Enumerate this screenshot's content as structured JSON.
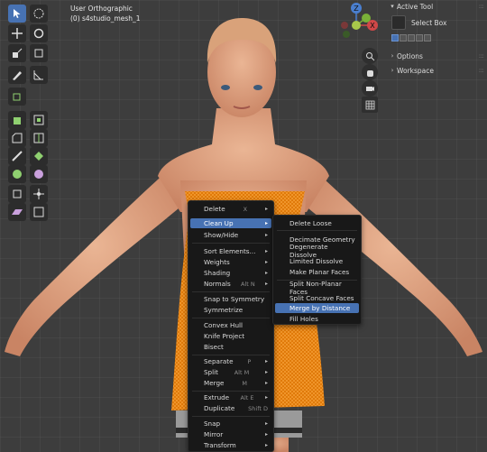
{
  "viewport": {
    "view_name": "User Orthographic",
    "object_name": "(0) s4studio_mesh_1"
  },
  "gizmo": {
    "axes": [
      "X",
      "Y",
      "Z"
    ]
  },
  "side_panel": {
    "active_tool_header": "Active Tool",
    "select_box_label": "Select Box",
    "options_header": "Options",
    "workspace_header": "Workspace"
  },
  "context_menu": {
    "items": [
      {
        "label": "Delete",
        "shortcut": "X",
        "submenu": true
      },
      {
        "label": "Clean Up",
        "submenu": true,
        "highlighted": true
      },
      {
        "label": "Show/Hide",
        "submenu": true
      },
      {
        "label": "Sort Elements...",
        "submenu": true
      },
      {
        "label": "Weights",
        "submenu": true
      },
      {
        "label": "Shading",
        "submenu": true
      },
      {
        "label": "Normals",
        "shortcut": "Alt N",
        "submenu": true
      },
      {
        "label": "Snap to Symmetry"
      },
      {
        "label": "Symmetrize"
      },
      {
        "label": "Convex Hull"
      },
      {
        "label": "Knife Project"
      },
      {
        "label": "Bisect"
      },
      {
        "label": "Separate",
        "shortcut": "P",
        "submenu": true
      },
      {
        "label": "Split",
        "shortcut": "Alt M",
        "submenu": true
      },
      {
        "label": "Merge",
        "shortcut": "M",
        "submenu": true
      },
      {
        "label": "Extrude",
        "shortcut": "Alt E",
        "submenu": true
      },
      {
        "label": "Duplicate",
        "shortcut": "Shift D"
      },
      {
        "label": "Snap",
        "submenu": true
      },
      {
        "label": "Mirror",
        "submenu": true
      },
      {
        "label": "Transform",
        "submenu": true
      }
    ]
  },
  "cleanup_submenu": {
    "items": [
      {
        "label": "Delete Loose"
      },
      {
        "label": "Decimate Geometry"
      },
      {
        "label": "Degenerate Dissolve"
      },
      {
        "label": "Limited Dissolve"
      },
      {
        "label": "Make Planar Faces"
      },
      {
        "label": "Split Non-Planar Faces"
      },
      {
        "label": "Split Concave Faces"
      },
      {
        "label": "Merge by Distance",
        "highlighted": true
      },
      {
        "label": "Fill Holes"
      }
    ]
  },
  "colors": {
    "viewport_bg": "#3d3d3d",
    "menu_bg": "#181818",
    "highlight": "#4772b3",
    "skin": "#d99a76",
    "dress_wire": "#ff8a10"
  },
  "icons": {
    "toolbar": [
      "select-box-icon",
      "cursor-icon",
      "move-icon",
      "rotate-icon",
      "scale-icon",
      "transform-icon",
      "annotate-icon",
      "measure-icon",
      "add-cube-icon",
      "extrude-icon",
      "inset-icon",
      "bevel-icon",
      "loop-cut-icon",
      "knife-icon",
      "poly-build-icon",
      "spin-icon",
      "smooth-icon",
      "edge-slide-icon",
      "shrink-fatten-icon",
      "shear-icon",
      "rip-icon"
    ],
    "navigation": [
      "zoom-icon",
      "hand-icon",
      "camera-icon",
      "grid-icon"
    ]
  }
}
